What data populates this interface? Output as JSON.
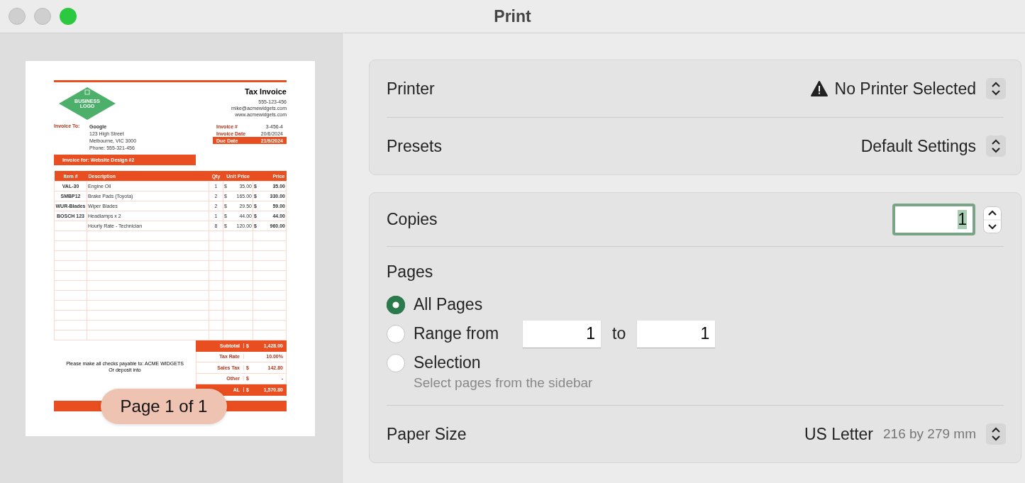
{
  "window": {
    "title": "Print"
  },
  "preview": {
    "invoice": {
      "logo_text": "BUSINESS LOGO",
      "title": "Tax Invoice",
      "contact": [
        "555-123-456",
        "mike@acmewidgets.com",
        "www.acmewidgets.com"
      ],
      "bill_to_label": "Invoice To:",
      "bill_to": [
        "Google",
        "123 High Street",
        "Melbourne, VIC 3000",
        "Phone: 555-321-456"
      ],
      "meta": [
        {
          "label": "Invoice #",
          "value": "3-456-4",
          "highlight": false
        },
        {
          "label": "Invoice Date",
          "value": "20/6/2024",
          "highlight": false
        },
        {
          "label": "Due Date",
          "value": "21/9/2024",
          "highlight": true
        }
      ],
      "project": "Invoice for: Website Design #2",
      "columns": [
        "Item #",
        "Description",
        "Qty",
        "Unit Price",
        "Price"
      ],
      "rows": [
        {
          "item": "VAL-30",
          "description": "Engine Oil",
          "qty": "1",
          "unit_currency": "$",
          "unit_price": "35.00",
          "price_currency": "$",
          "price": "35.00"
        },
        {
          "item": "SMBP12",
          "description": "Brake Pads (Toyota)",
          "qty": "2",
          "unit_currency": "$",
          "unit_price": "165.00",
          "price_currency": "$",
          "price": "330.00"
        },
        {
          "item": "WUR-Blades",
          "description": "Wiper Blades",
          "qty": "2",
          "unit_currency": "$",
          "unit_price": "29.50",
          "price_currency": "$",
          "price": "59.00"
        },
        {
          "item": "BOSCH 123",
          "description": "Headlamps x 2",
          "qty": "1",
          "unit_currency": "$",
          "unit_price": "44.00",
          "price_currency": "$",
          "price": "44.00"
        },
        {
          "item": "",
          "description": "Hourly Rate - Technician",
          "qty": "8",
          "unit_currency": "$",
          "unit_price": "120.00",
          "price_currency": "$",
          "price": "960.00"
        }
      ],
      "note": [
        "Please make all checks payable to: ACME WIDGETS",
        "Or deposit into"
      ],
      "summary": [
        {
          "label": "Subtotal",
          "currency": "$",
          "value": "1,428.00",
          "highlight": true
        },
        {
          "label": "Tax Rate",
          "value": "10.00%",
          "highlight": false
        },
        {
          "label": "Sales Tax",
          "currency": "$",
          "value": "142.80",
          "highlight": false
        },
        {
          "label": "Other",
          "currency": "$",
          "value": "-",
          "highlight": false
        },
        {
          "label": "AL",
          "currency": "$",
          "value": "1,570.80",
          "highlight": true
        }
      ]
    },
    "page_indicator": "Page 1 of 1"
  },
  "printer": {
    "label": "Printer",
    "value": "No Printer Selected"
  },
  "presets": {
    "label": "Presets",
    "value": "Default Settings"
  },
  "copies": {
    "label": "Copies",
    "value": "1"
  },
  "pages": {
    "label": "Pages",
    "options": [
      {
        "label": "All Pages",
        "selected": true
      },
      {
        "label": "Range from",
        "selected": false
      },
      {
        "label": "Selection",
        "selected": false
      }
    ],
    "range_from": "1",
    "range_to_label": "to",
    "range_to": "1",
    "hint": "Select pages from the sidebar"
  },
  "paper_size": {
    "label": "Paper Size",
    "value": "US Letter",
    "dimensions": "216 by 279 mm"
  }
}
